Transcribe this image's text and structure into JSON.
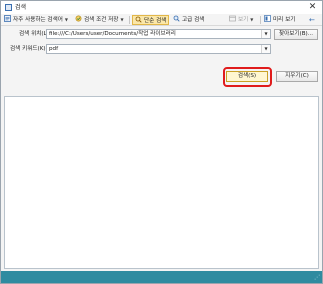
{
  "window": {
    "title": "검색"
  },
  "toolbar": {
    "recent": "자주 사용하는 검색어",
    "save_condition": "검색 조건 저장",
    "simple_search": "단순 검색",
    "advanced_search": "고급 검색",
    "view": "보기",
    "preview": "미리 보기",
    "back_arrow": "←"
  },
  "form": {
    "location_label": "검색 위치(L):",
    "location_value": "file:///C:/Users/user/Documents/작업 라이브러리",
    "browse_label": "찾아보기(B)...",
    "keyword_label": "검색 키워드(K):",
    "keyword_value": "pdf"
  },
  "actions": {
    "search_label": "검색(S)",
    "clear_label": "지우기(C)"
  },
  "colors": {
    "accent_highlight": "#e01c1c",
    "status_bar": "#2f8ba0",
    "active_tab": "#fbe7a8"
  }
}
